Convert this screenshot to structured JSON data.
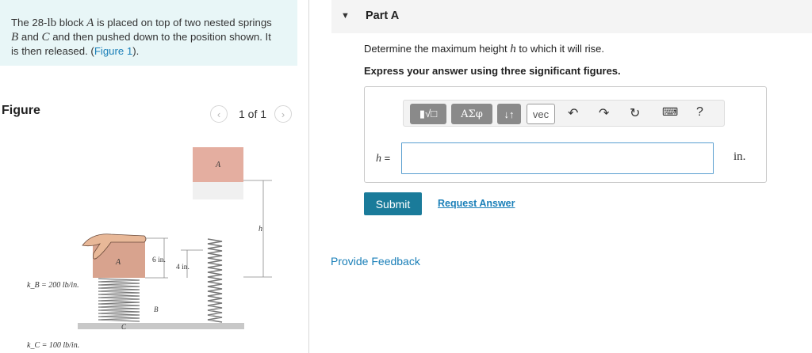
{
  "problem": {
    "line1_a": "The 28-",
    "line1_unit": "lb",
    "line1_b": " block ",
    "line1_var": "A",
    "line1_c": " is placed on top of two nested springs",
    "line2_var1": "B",
    "line2_a": " and ",
    "line2_var2": "C",
    "line2_b": " and then pushed down to the position shown. It",
    "line3_a": "is then released. (",
    "line3_link": "Figure 1",
    "line3_b": ")."
  },
  "figure": {
    "label": "Figure",
    "pager_text": "1 of 1",
    "prev_icon": "chevron-left-icon",
    "next_icon": "chevron-right-icon",
    "block_label": "A",
    "dim_6in": "6 in.",
    "dim_4in": "4 in.",
    "h_label": "h",
    "kb_label": "k_B = 200 lb/in.",
    "kc_label": "k_C = 100 lb/in.",
    "b_label": "B",
    "c_label": "C"
  },
  "part": {
    "title": "Part A",
    "question_a": "Determine the maximum height ",
    "question_var": "h",
    "question_b": " to which it will rise.",
    "instruction": "Express your answer using three significant figures."
  },
  "toolbar": {
    "templates_icon": "templates-sqrt-icon",
    "greek_label": "ΑΣφ",
    "arrows_label": "↓↑",
    "vec_label": "vec",
    "undo_icon": "undo-icon",
    "redo_icon": "redo-icon",
    "reset_icon": "reset-icon",
    "keyboard_icon": "keyboard-icon",
    "help_label": "?"
  },
  "answer": {
    "var_label": "h",
    "eq": " =",
    "value": "",
    "unit": "in."
  },
  "actions": {
    "submit_label": "Submit",
    "request_answer_label": "Request Answer",
    "feedback_label": "Provide Feedback"
  }
}
